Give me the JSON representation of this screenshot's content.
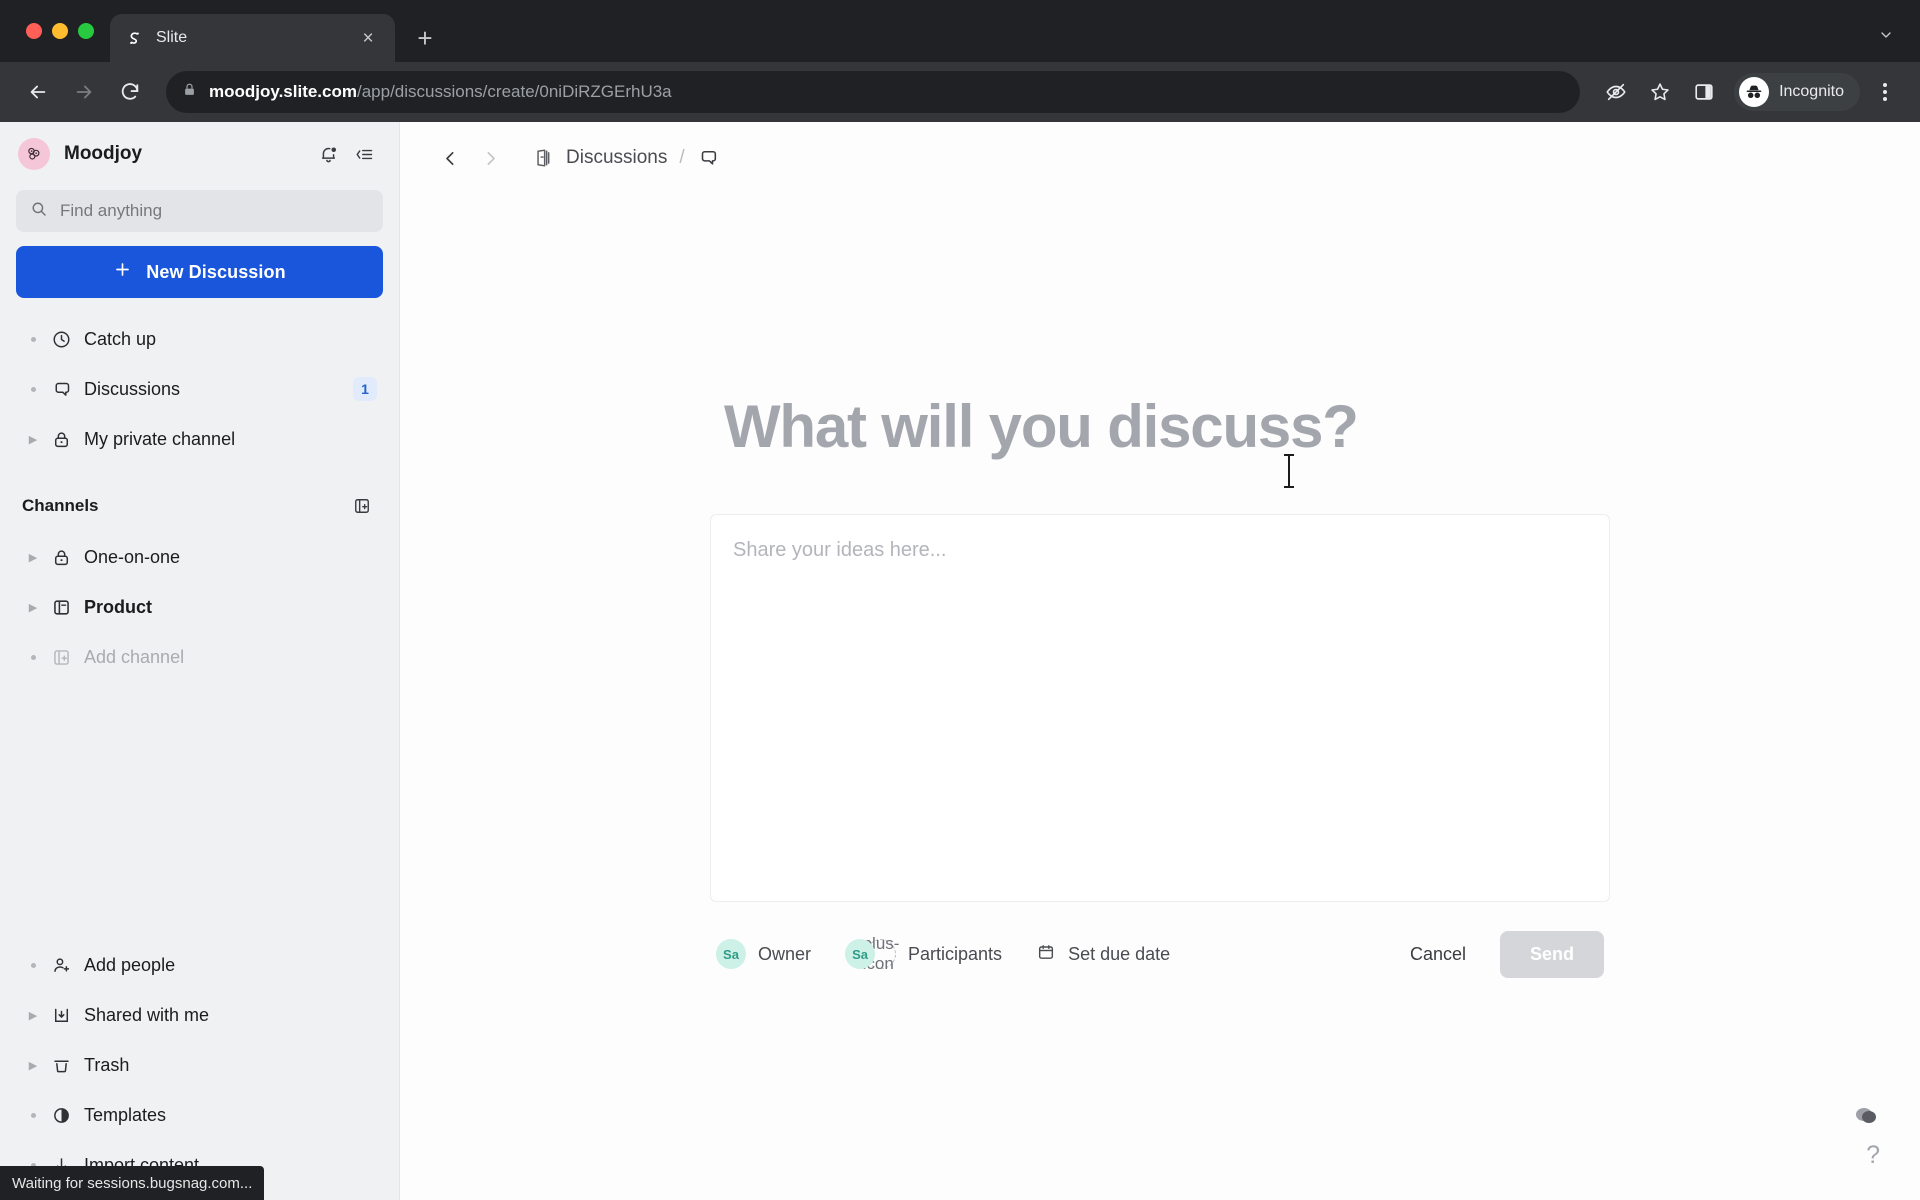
{
  "browser": {
    "tab": {
      "title": "Slite",
      "favicon": "slite-favicon",
      "close_label": "×"
    },
    "new_tab_label": "+",
    "window_chevron": "⌄",
    "nav": {
      "back": "←",
      "forward": "→",
      "reload": "↻"
    },
    "omnibox": {
      "lock_icon": "lock-icon",
      "host": "moodjoy.slite.com",
      "path": "/app/discussions/create/0niDiRZGErhU3a",
      "full_url": "moodjoy.slite.com/app/discussions/create/0niDiRZGErhU3a"
    },
    "toolbar_icons": [
      "eye-off-icon",
      "bookmark-star-icon",
      "side-panel-icon"
    ],
    "profile": {
      "label": "Incognito",
      "icon": "incognito-icon"
    },
    "menu_icon": "three-dot-menu-icon",
    "status_text": "Waiting for sessions.bugsnag.com..."
  },
  "sidebar": {
    "workspace": {
      "name": "Moodjoy",
      "logo": "moodjoy-logo"
    },
    "bell_icon": "notification-bell-icon",
    "collapse_icon": "collapse-sidebar-icon",
    "search": {
      "placeholder": "Find anything",
      "icon": "search-icon"
    },
    "new_discussion": {
      "label": "New Discussion",
      "icon": "plus-icon",
      "color": "#1a56db"
    },
    "nav_items": [
      {
        "label": "Catch up",
        "icon": "clock-icon",
        "marker": "bullet",
        "badge": ""
      },
      {
        "label": "Discussions",
        "icon": "discussion-bubble-icon",
        "marker": "bullet",
        "badge": "1"
      },
      {
        "label": "My private channel",
        "icon": "lock-icon",
        "marker": "twisty",
        "badge": ""
      }
    ],
    "channels_section": {
      "title": "Channels",
      "add_icon": "add-channel-icon",
      "items": [
        {
          "label": "One-on-one",
          "icon": "lock-icon",
          "marker": "twisty",
          "muted": false,
          "bold": false
        },
        {
          "label": "Product",
          "icon": "channel-icon",
          "marker": "twisty",
          "muted": false,
          "bold": true
        },
        {
          "label": "Add channel",
          "icon": "add-channel-icon",
          "marker": "bullet",
          "muted": true,
          "bold": false
        }
      ]
    },
    "bottom_items": [
      {
        "label": "Add people",
        "icon": "add-person-icon",
        "marker": "bullet"
      },
      {
        "label": "Shared with me",
        "icon": "inbox-download-icon",
        "marker": "twisty"
      },
      {
        "label": "Trash",
        "icon": "trash-icon",
        "marker": "twisty"
      },
      {
        "label": "Templates",
        "icon": "templates-icon",
        "marker": "bullet"
      },
      {
        "label": "Import content",
        "icon": "import-arrow-icon",
        "marker": "bullet"
      }
    ]
  },
  "main": {
    "breadcrumb": {
      "back_icon": "chevron-left-icon",
      "forward_icon": "chevron-right-icon",
      "doc_icon": "discussions-doc-icon",
      "label": "Discussions",
      "separator": "/",
      "current_icon": "discussion-bubble-icon"
    },
    "compose": {
      "title_placeholder": "What will you discuss?",
      "body_placeholder": "Share your ideas here...",
      "owner": {
        "avatar_initials": "Sa",
        "label": "Owner",
        "avatar_color": "#cdf0e7"
      },
      "participants": {
        "avatar_initials": "Sa",
        "add_icon": "plus-icon",
        "label": "Participants"
      },
      "due_date": {
        "icon": "calendar-icon",
        "label": "Set due date"
      },
      "cancel_label": "Cancel",
      "send_label": "Send",
      "send_disabled": true
    },
    "floating": {
      "disc_icon": "mood-disc-icon",
      "help_label": "?"
    }
  }
}
